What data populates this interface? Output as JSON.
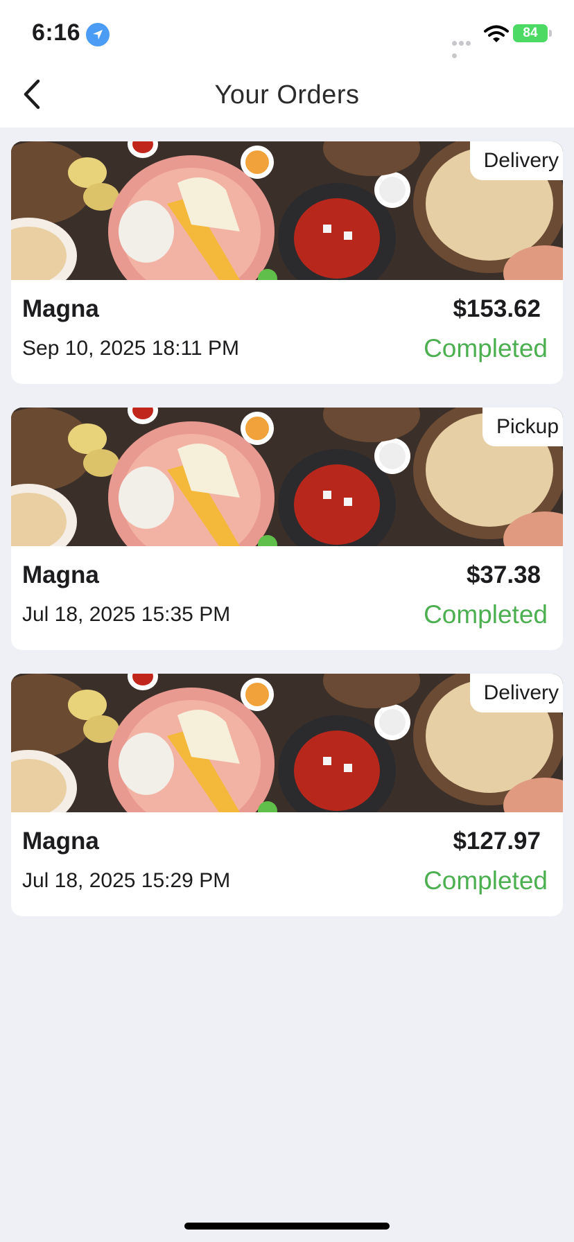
{
  "status_bar": {
    "time": "6:16",
    "battery": "84"
  },
  "header": {
    "title": "Your Orders",
    "back_icon": "chevron-left-icon"
  },
  "colors": {
    "status_completed": "#4CAF50",
    "background": "#EFF0F5"
  },
  "orders": [
    {
      "type": "Delivery",
      "restaurant": "Magna",
      "date": "Sep 10, 2025 18:11 PM",
      "total": "$153.62",
      "status": "Completed"
    },
    {
      "type": "Pickup",
      "restaurant": "Magna",
      "date": "Jul 18, 2025 15:35 PM",
      "total": "$37.38",
      "status": "Completed"
    },
    {
      "type": "Delivery",
      "restaurant": "Magna",
      "date": "Jul 18, 2025 15:29 PM",
      "total": "$127.97",
      "status": "Completed"
    }
  ]
}
